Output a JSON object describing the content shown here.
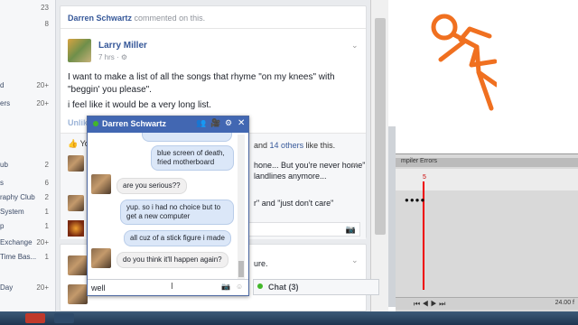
{
  "sidebar": {
    "items": [
      {
        "label": "",
        "count": "23"
      },
      {
        "label": "",
        "count": "8"
      },
      {
        "label": "d",
        "count": "20+"
      },
      {
        "label": "ers",
        "count": "20+"
      },
      {
        "label": "ub",
        "count": "2"
      },
      {
        "label": "s",
        "count": "6"
      },
      {
        "label": "raphy Club",
        "count": "2"
      },
      {
        "label": "System",
        "count": "1"
      },
      {
        "label": "p",
        "count": "1"
      },
      {
        "label": "Exchange",
        "count": "20+"
      },
      {
        "label": "Time Bas...",
        "count": "1"
      },
      {
        "label": "Day",
        "count": "20+"
      }
    ]
  },
  "feed": {
    "header_name": "Darren Schwartz",
    "header_suffix": "commented on this.",
    "post": {
      "author": "Larry Miller",
      "time": "7 hrs",
      "text1": "I want to make a list of all the songs that rhyme \"on my knees\" with \"beggin' you please\".",
      "text2": "i feel like it would be a very long list.",
      "action_unlike": "Unlik"
    },
    "likes": {
      "prefix": "Yo",
      "and": "and",
      "others": "14 others",
      "suffix": "like this."
    },
    "comment1": "hone... But you're never home\"",
    "comment1b": "landlines anymore...",
    "comment2": "r\" and \"just don't care\"",
    "comment3": "ure."
  },
  "chat": {
    "name": "Darren Schwartz",
    "messages": [
      {
        "from": "me",
        "text": "blue screen of death, fried motherboard"
      },
      {
        "from": "them",
        "text": "are you serious??"
      },
      {
        "from": "me",
        "text": "yup. so i had no choice but to get a new computer"
      },
      {
        "from": "me",
        "text": "all cuz of a stick figure i made"
      },
      {
        "from": "them",
        "text": "do you think it'll happen again?"
      }
    ],
    "input_value": "well"
  },
  "chatbar": {
    "label": "Chat (3)"
  },
  "anim": {
    "panel_title": "mpiler Errors",
    "frame": "5",
    "rate": "24.00 f"
  }
}
